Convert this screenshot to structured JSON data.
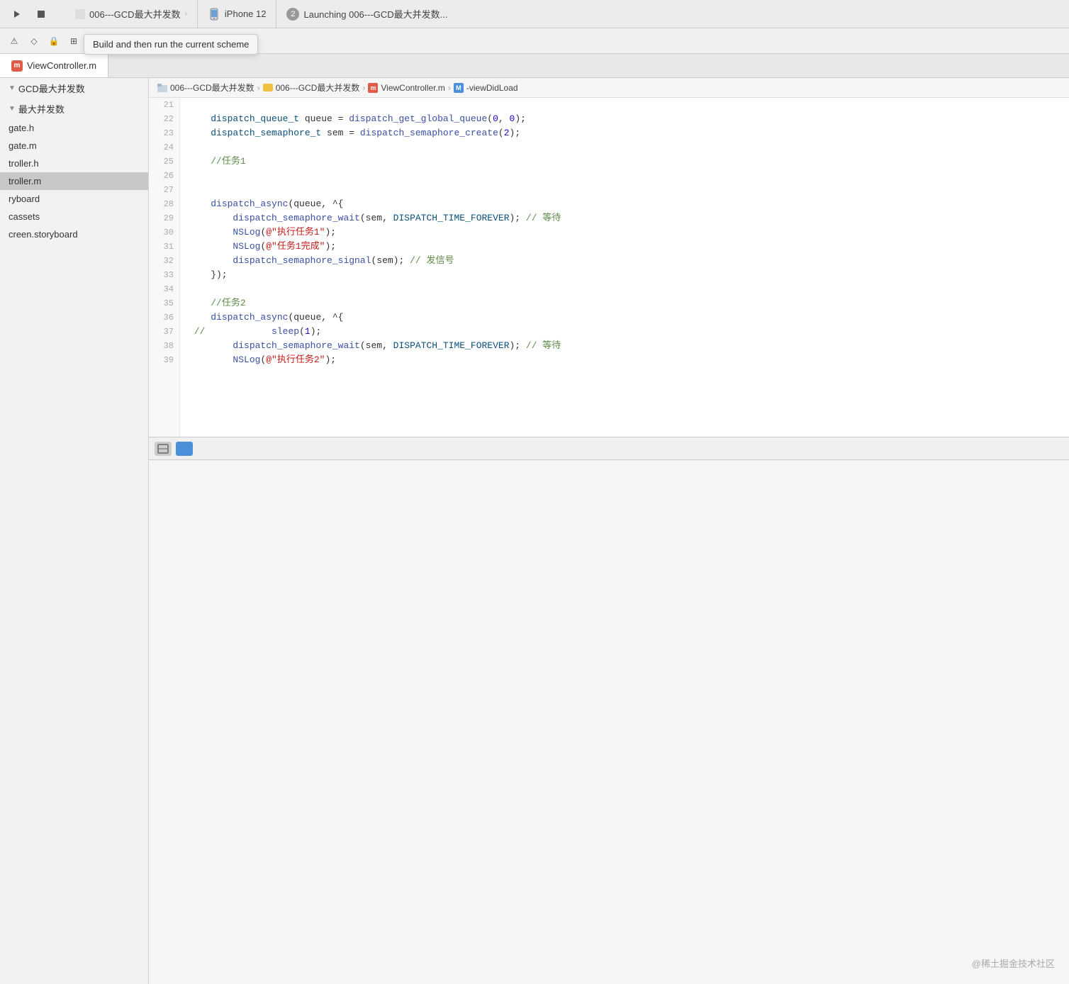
{
  "titlebar": {
    "run_btn": "▶",
    "stop_btn": "■",
    "tab1": "006---GCD最大并发数",
    "iphone_label": "iPhone 12",
    "launch_badge": "2",
    "launch_label": "Launching 006---GCD最大并发数..."
  },
  "tooltip": {
    "text": "Build and then run the current scheme"
  },
  "tab_bar": {
    "file_label": "ViewController.m"
  },
  "breadcrumb": {
    "project1": "006---GCD最大并发数",
    "project2": "006---GCD最大并发数",
    "file_m": "m",
    "file_name": "ViewController.m",
    "method_label": "M",
    "method_name": "-viewDidLoad"
  },
  "sidebar": {
    "items": [
      {
        "label": "GCD最大并发数",
        "type": "group"
      },
      {
        "label": "最大并发数",
        "type": "group"
      },
      {
        "label": "gate.h",
        "type": "file"
      },
      {
        "label": "gate.m",
        "type": "file"
      },
      {
        "label": "troller.h",
        "type": "file"
      },
      {
        "label": "troller.m",
        "type": "file",
        "active": true
      },
      {
        "label": "ryboard",
        "type": "file"
      },
      {
        "label": "cassets",
        "type": "file"
      },
      {
        "label": "creen.storyboard",
        "type": "file"
      }
    ]
  },
  "code": {
    "lines": [
      {
        "num": 21,
        "content": ""
      },
      {
        "num": 22,
        "tokens": [
          {
            "t": "type",
            "v": "dispatch_queue_t"
          },
          {
            "t": "plain",
            "v": " queue = "
          },
          {
            "t": "func",
            "v": "dispatch_get_global_queue"
          },
          {
            "t": "plain",
            "v": "("
          },
          {
            "t": "num",
            "v": "0"
          },
          {
            "t": "plain",
            "v": ", "
          },
          {
            "t": "num",
            "v": "0"
          },
          {
            "t": "plain",
            "v": "); "
          }
        ]
      },
      {
        "num": 23,
        "tokens": [
          {
            "t": "type",
            "v": "dispatch_semaphore_t"
          },
          {
            "t": "plain",
            "v": " sem = "
          },
          {
            "t": "func",
            "v": "dispatch_semaphore_create"
          },
          {
            "t": "plain",
            "v": "("
          },
          {
            "t": "num",
            "v": "2"
          },
          {
            "t": "plain",
            "v": "); "
          }
        ]
      },
      {
        "num": 24,
        "content": ""
      },
      {
        "num": 25,
        "tokens": [
          {
            "t": "comment",
            "v": "//任务1"
          }
        ]
      },
      {
        "num": 26,
        "content": ""
      },
      {
        "num": 27,
        "content": ""
      },
      {
        "num": 28,
        "tokens": [
          {
            "t": "func",
            "v": "dispatch_async"
          },
          {
            "t": "plain",
            "v": "(queue, ^{"
          }
        ]
      },
      {
        "num": 29,
        "tokens": [
          {
            "t": "plain",
            "v": "        "
          },
          {
            "t": "func",
            "v": "dispatch_semaphore_wait"
          },
          {
            "t": "plain",
            "v": "(sem, "
          },
          {
            "t": "type",
            "v": "DISPATCH_TIME_FOREVER"
          },
          {
            "t": "plain",
            "v": "); "
          },
          {
            "t": "comment",
            "v": "// 等待"
          }
        ]
      },
      {
        "num": 30,
        "tokens": [
          {
            "t": "plain",
            "v": "        "
          },
          {
            "t": "func",
            "v": "NSLog"
          },
          {
            "t": "plain",
            "v": "("
          },
          {
            "t": "str",
            "v": "@\"执行任务1\""
          },
          {
            "t": "plain",
            "v": "); "
          }
        ]
      },
      {
        "num": 31,
        "tokens": [
          {
            "t": "plain",
            "v": "        "
          },
          {
            "t": "func",
            "v": "NSLog"
          },
          {
            "t": "plain",
            "v": "("
          },
          {
            "t": "str",
            "v": "@\"任务1完成\""
          },
          {
            "t": "plain",
            "v": "); "
          }
        ]
      },
      {
        "num": 32,
        "tokens": [
          {
            "t": "plain",
            "v": "        "
          },
          {
            "t": "func",
            "v": "dispatch_semaphore_signal"
          },
          {
            "t": "plain",
            "v": "(sem); "
          },
          {
            "t": "comment",
            "v": "// 发信号"
          }
        ]
      },
      {
        "num": 33,
        "tokens": [
          {
            "t": "plain",
            "v": "    }); "
          }
        ]
      },
      {
        "num": 34,
        "content": ""
      },
      {
        "num": 35,
        "tokens": [
          {
            "t": "comment",
            "v": "//任务2"
          }
        ]
      },
      {
        "num": 36,
        "tokens": [
          {
            "t": "plain",
            "v": "    "
          },
          {
            "t": "func",
            "v": "dispatch_async"
          },
          {
            "t": "plain",
            "v": "(queue, ^{"
          }
        ]
      },
      {
        "num": 37,
        "tokens": [
          {
            "t": "comment",
            "v": "//"
          },
          {
            "t": "plain",
            "v": "            "
          },
          {
            "t": "func",
            "v": "sleep"
          },
          {
            "t": "plain",
            "v": "("
          },
          {
            "t": "num",
            "v": "1"
          },
          {
            "t": "plain",
            "v": "); "
          }
        ]
      },
      {
        "num": 38,
        "tokens": [
          {
            "t": "plain",
            "v": "        "
          },
          {
            "t": "func",
            "v": "dispatch_semaphore_wait"
          },
          {
            "t": "plain",
            "v": "(sem, "
          },
          {
            "t": "type",
            "v": "DISPATCH_TIME_FOREVER"
          },
          {
            "t": "plain",
            "v": "); "
          },
          {
            "t": "comment",
            "v": "// 等待"
          }
        ]
      },
      {
        "num": 39,
        "tokens": [
          {
            "t": "plain",
            "v": "        "
          },
          {
            "t": "func",
            "v": "NSLog"
          },
          {
            "t": "plain",
            "v": "("
          },
          {
            "t": "str",
            "v": "@\"执行任务2\""
          },
          {
            "t": "plain",
            "v": "); "
          }
        ]
      }
    ]
  },
  "watermark": "@稀土掘金技术社区"
}
